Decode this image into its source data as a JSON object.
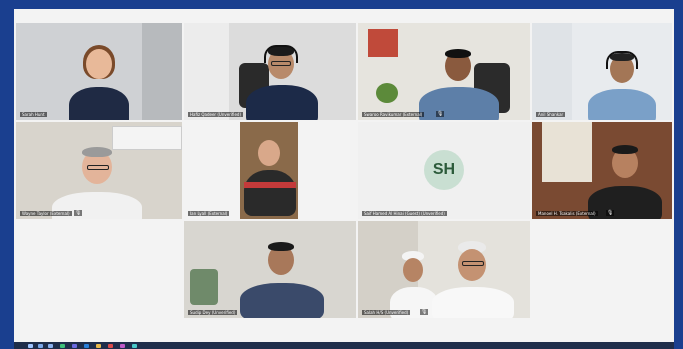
{
  "participants": [
    {
      "name": "Sarah Hunt",
      "mic": false
    },
    {
      "name": "Hafiz Qadeer (Unverified)",
      "mic": false
    },
    {
      "name": "Swaroo Ravikumar (External)",
      "mic": true
    },
    {
      "name": "Anil Shankar",
      "mic": false
    },
    {
      "name": "Wayne Taylor (External)",
      "mic": true
    },
    {
      "name": "Ian Lyall (External)",
      "mic": false
    },
    {
      "name": "Saif Hamed Al Hinai (Guest) (Unverified)",
      "mic": false
    },
    {
      "name": "Manoel H. Tsakalis (External)",
      "mic": true
    },
    {
      "name": "Sudip Dey (Unverified)",
      "mic": false
    },
    {
      "name": "Salah H/S (Unverified)",
      "mic": true
    }
  ],
  "avatar_initials": "SH",
  "colors": {
    "frame": "#1a3f8f",
    "grid_bg": "#f3f3f3",
    "avatar_bg": "#c9dfd2",
    "avatar_text": "#2b5a3a"
  },
  "icons": {
    "mic": "microphone-icon"
  }
}
